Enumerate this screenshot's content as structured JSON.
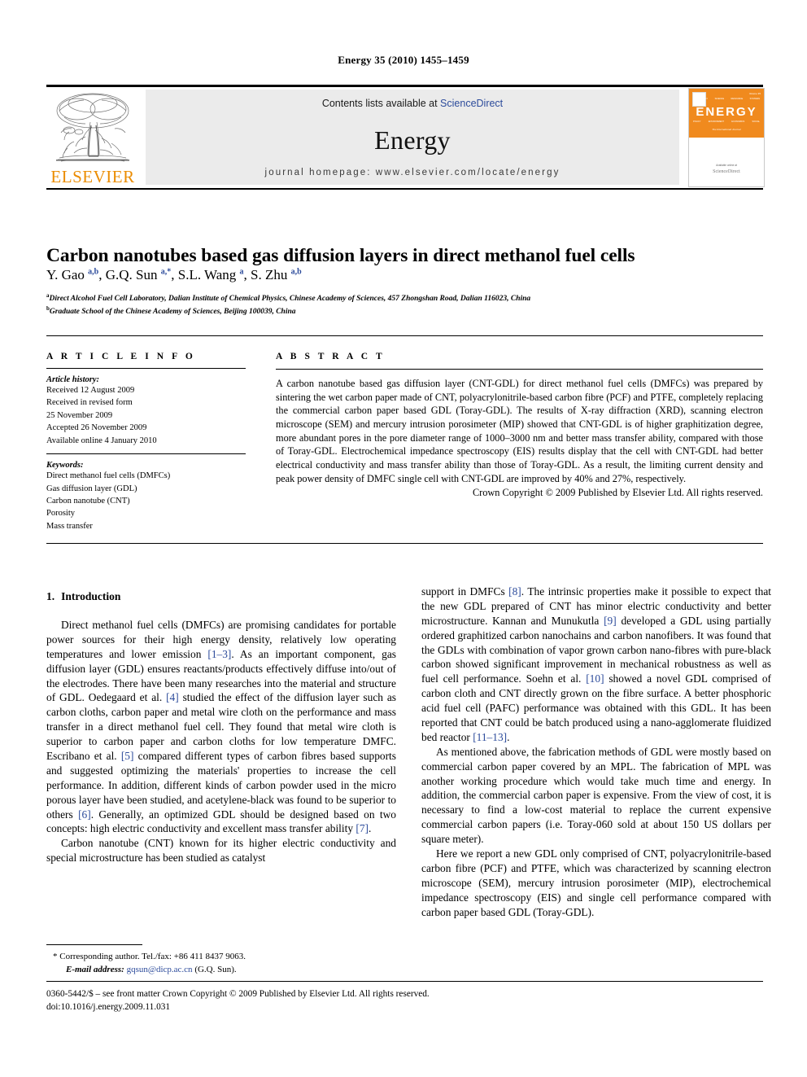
{
  "running_head": "Energy 35 (2010) 1455–1459",
  "masthead": {
    "publisher_wordmark": "ELSEVIER",
    "contents_prefix": "Contents lists available at ",
    "contents_link": "ScienceDirect",
    "journal_name": "Energy",
    "homepage": "journal homepage: www.elsevier.com/locate/energy",
    "cover": {
      "title": "ENERGY",
      "subtitle": "The International Journal",
      "issue": "Volume 35",
      "top_row": [
        "TECHNOLOGY",
        "SCIENCE",
        "RESOURCE",
        "SYSTEMS"
      ],
      "bottom_row": [
        "POLICY",
        "ENVIRONMENT",
        "ECONOMICS",
        "SOCIAL"
      ],
      "footer_prefix": "Available online at",
      "footer_brand": "ScienceDirect",
      "footer_url": "www.sciencedirect.com"
    },
    "accent_color": "#eb8c00",
    "link_color": "#2c4b9b",
    "banner_bg": "#ebebeb"
  },
  "article": {
    "title": "Carbon nanotubes based gas diffusion layers in direct methanol fuel cells",
    "authors_html": "Y. Gao <sup>a,b</sup>, G.Q. Sun <sup>a,*</sup>, S.L. Wang <sup>a</sup>, S. Zhu <sup>a,b</sup>",
    "affiliations": [
      "Direct Alcohol Fuel Cell Laboratory, Dalian Institute of Chemical Physics, Chinese Academy of Sciences, 457 Zhongshan Road, Dalian 116023, China",
      "Graduate School of the Chinese Academy of Sciences, Beijing 100039, China"
    ],
    "affiliation_marks": [
      "a",
      "b"
    ]
  },
  "article_info": {
    "heading": "A R T I C L E   I N F O",
    "history_label": "Article history:",
    "history": [
      "Received 12 August 2009",
      "Received in revised form",
      "25 November 2009",
      "Accepted 26 November 2009",
      "Available online 4 January 2010"
    ],
    "keywords_label": "Keywords:",
    "keywords": [
      "Direct methanol fuel cells (DMFCs)",
      "Gas diffusion layer (GDL)",
      "Carbon nanotube (CNT)",
      "Porosity",
      "Mass transfer"
    ]
  },
  "abstract": {
    "heading": "A B S T R A C T",
    "text": "A carbon nanotube based gas diffusion layer (CNT-GDL) for direct methanol fuel cells (DMFCs) was prepared by sintering the wet carbon paper made of CNT, polyacrylonitrile-based carbon fibre (PCF) and PTFE, completely replacing the commercial carbon paper based GDL (Toray-GDL). The results of X-ray diffraction (XRD), scanning electron microscope (SEM) and mercury intrusion porosimeter (MIP) showed that CNT-GDL is of higher graphitization degree, more abundant pores in the pore diameter range of 1000–3000 nm and better mass transfer ability, compared with those of Toray-GDL. Electrochemical impedance spectroscopy (EIS) results display that the cell with CNT-GDL had better electrical conductivity and mass transfer ability than those of Toray-GDL. As a result, the limiting current density and peak power density of DMFC single cell with CNT-GDL are improved by 40% and 27%, respectively.",
    "copyright": "Crown Copyright © 2009 Published by Elsevier Ltd. All rights reserved."
  },
  "body": {
    "section_number": "1.",
    "section_title": "Introduction",
    "left_paragraphs": [
      "Direct methanol fuel cells (DMFCs) are promising candidates for portable power sources for their high energy density, relatively low operating temperatures and lower emission [1–3]. As an important component, gas diffusion layer (GDL) ensures reactants/products effectively diffuse into/out of the electrodes. There have been many researches into the material and structure of GDL. Oedegaard et al. [4] studied the effect of the diffusion layer such as carbon cloths, carbon paper and metal wire cloth on the performance and mass transfer in a direct methanol fuel cell. They found that metal wire cloth is superior to carbon paper and carbon cloths for low temperature DMFC. Escribano et al. [5] compared different types of carbon fibres based supports and suggested optimizing the materials' properties to increase the cell performance. In addition, different kinds of carbon powder used in the micro porous layer have been studied, and acetylene-black was found to be superior to others [6]. Generally, an optimized GDL should be designed based on two concepts: high electric conductivity and excellent mass transfer ability [7].",
      "Carbon nanotube (CNT) known for its higher electric conductivity and special microstructure has been studied as catalyst"
    ],
    "right_paragraphs": [
      "support in DMFCs [8]. The intrinsic properties make it possible to expect that the new GDL prepared of CNT has minor electric conductivity and better microstructure. Kannan and Munukutla [9] developed a GDL using partially ordered graphitized carbon nanochains and carbon nanofibers. It was found that the GDLs with combination of vapor grown carbon nano-fibres with pure-black carbon showed significant improvement in mechanical robustness as well as fuel cell performance. Soehn et al. [10] showed a novel GDL comprised of carbon cloth and CNT directly grown on the fibre surface. A better phosphoric acid fuel cell (PAFC) performance was obtained with this GDL. It has been reported that CNT could be batch produced using a nano-agglomerate fluidized bed reactor [11–13].",
      "As mentioned above, the fabrication methods of GDL were mostly based on commercial carbon paper covered by an MPL. The fabrication of MPL was another working procedure which would take much time and energy. In addition, the commercial carbon paper is expensive. From the view of cost, it is necessary to find a low-cost material to replace the current expensive commercial carbon papers (i.e. Toray-060 sold at about 150 US dollars per square meter).",
      "Here we report a new GDL only comprised of CNT, polyacrylonitrile-based carbon fibre (PCF) and PTFE, which was characterized by scanning electron microscope (SEM), mercury intrusion porosimeter (MIP), electrochemical impedance spectroscopy (EIS) and single cell performance compared with carbon paper based GDL (Toray-GDL)."
    ],
    "reference_tokens": [
      "[1–3]",
      "[4]",
      "[5]",
      "[6]",
      "[7]",
      "[8]",
      "[9]",
      "[10]",
      "[11–13]"
    ]
  },
  "footnote": {
    "corresponding": "* Corresponding author. Tel./fax: +86 411 8437 9063.",
    "email_label": "E-mail address:",
    "email": "gqsun@dicp.ac.cn",
    "email_owner": "(G.Q. Sun)."
  },
  "imprint": {
    "line1": "0360-5442/$ – see front matter Crown Copyright © 2009 Published by Elsevier Ltd. All rights reserved.",
    "line2": "doi:10.1016/j.energy.2009.11.031"
  }
}
